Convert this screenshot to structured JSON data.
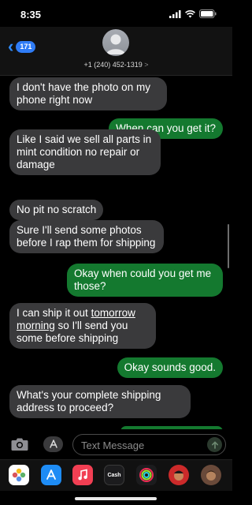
{
  "status": {
    "time": "8:35"
  },
  "header": {
    "back_count": "171",
    "contact_number": "+1 (240) 452-1319",
    "contact_chevron": ">"
  },
  "messages": [
    {
      "dir": "in",
      "text": "I don't have the photo on my phone right now"
    },
    {
      "dir": "out",
      "text": "When can you get it?"
    },
    {
      "dir": "in",
      "text": "Like I said we sell all parts in mint condition no repair or damage"
    },
    {
      "dir": "in",
      "text": "No pit no scratch"
    },
    {
      "dir": "in",
      "text": "Sure I'll send some photos before I rap them for shipping"
    },
    {
      "dir": "out",
      "text": "Okay when could you get me those?"
    },
    {
      "dir": "in",
      "text_a": "I can ship it out ",
      "text_link": "tomorrow morning",
      "text_b": " so I'll send you some before shipping"
    },
    {
      "dir": "out",
      "text": "Okay sounds good."
    },
    {
      "dir": "in",
      "text": "What's your complete shipping address to proceed?"
    }
  ],
  "compose": {
    "placeholder": "Text Message"
  },
  "app_drawer": {
    "apps": [
      {
        "name": "photos-app-icon",
        "color": "#ffffff"
      },
      {
        "name": "app-store-icon",
        "color": "#1e8cf5"
      },
      {
        "name": "music-icon",
        "color": "#f23f53"
      },
      {
        "name": "apple-cash-icon",
        "color": "#1c1c1e",
        "label": "Cash"
      },
      {
        "name": "activity-icon",
        "color": "#1c1c1e"
      },
      {
        "name": "memoji-icon-1",
        "color": "#cc2a2a"
      },
      {
        "name": "memoji-icon-2",
        "color": "#6a4a3a"
      }
    ]
  },
  "colors": {
    "incoming": "#3a3a3c",
    "outgoing": "#14792f",
    "accent": "#2f8cff"
  }
}
